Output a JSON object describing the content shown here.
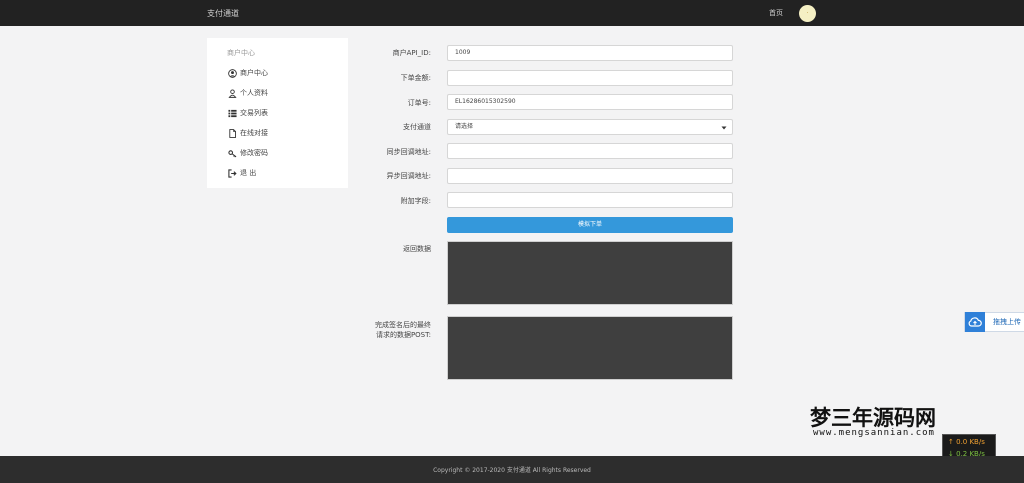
{
  "header": {
    "brand": "支付通道",
    "home_link": "首页",
    "avatar_text": "·"
  },
  "sidebar": {
    "title": "商户中心",
    "items": [
      {
        "label": "商户中心",
        "icon": "user-circle-icon"
      },
      {
        "label": "个人资料",
        "icon": "person-icon"
      },
      {
        "label": "交易列表",
        "icon": "list-icon"
      },
      {
        "label": "在线对接",
        "icon": "file-icon"
      },
      {
        "label": "修改密码",
        "icon": "key-icon"
      },
      {
        "label": "退 出",
        "icon": "logout-icon"
      }
    ]
  },
  "form": {
    "api_id": {
      "label": "商户API_ID:",
      "value": "1009"
    },
    "amount": {
      "label": "下单金额:",
      "value": ""
    },
    "order_no": {
      "label": "订单号:",
      "value": "EL16286015302590"
    },
    "channel": {
      "label": "支付通道",
      "selected": "请选择"
    },
    "sync_url": {
      "label": "同步回调地址:",
      "value": ""
    },
    "async_url": {
      "label": "异步回调地址:",
      "value": ""
    },
    "attach": {
      "label": "附加字段:",
      "value": ""
    },
    "submit_label": "模拟下单",
    "response": {
      "label": "返回数据"
    },
    "post_data": {
      "label_line1": "完成签名后的最终",
      "label_line2": "请求的数据POST:"
    }
  },
  "upload_widget": {
    "label": "拖拽上传"
  },
  "watermark": {
    "title": "梦三年源码网",
    "url": "www.mengsannian.com"
  },
  "netspeed": {
    "up": "0.0 KB/s",
    "down": "0.2 KB/s",
    "up_color": "#f0a030",
    "down_color": "#7dc142"
  },
  "footer": {
    "copyright": "Copyright © 2017-2020 支付通道 All Rights Reserved"
  },
  "colors": {
    "accent": "#3498db",
    "header_bg": "#222222",
    "footer_bg": "#2d2d2d"
  }
}
